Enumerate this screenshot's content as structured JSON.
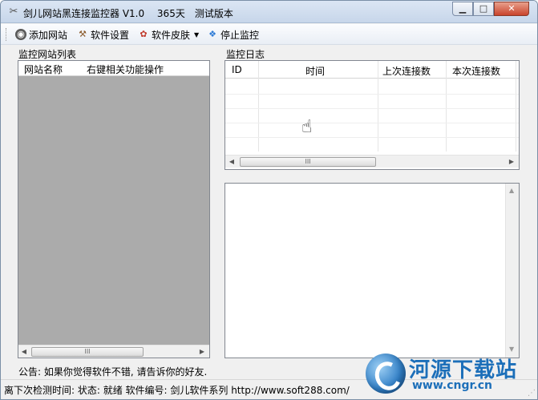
{
  "window": {
    "title": "剑儿网站黑连接监控器 V1.0　 365天　测试版本",
    "minimize_label": "▭",
    "maximize_label": "□",
    "close_label": "✕"
  },
  "toolbar": {
    "add_site": "添加网站",
    "settings": "软件设置",
    "skin": "软件皮肤",
    "stop": "停止监控"
  },
  "site_list": {
    "label": "监控网站列表",
    "columns": [
      "网站名称",
      "右键相关功能操作"
    ]
  },
  "monitor_log": {
    "label": "监控日志",
    "columns": [
      "ID",
      "时间",
      "上次连接数",
      "本次连接数"
    ]
  },
  "scrollbar": {
    "thumb_grip": "III"
  },
  "notice": "公告: 如果你觉得软件不错, 请告诉你的好友.",
  "status": "离下次检测时间:  状态: 就绪  软件编号: 剑儿软件系列  http://www.soft288.com/",
  "watermark": {
    "name": "河源下载站",
    "url": "www.cngr.cn"
  },
  "colors": {
    "list_body": "#ababab",
    "titlebar": "#c7d6ea",
    "watermark": "#1c6fb9",
    "close_button": "#c9442c"
  }
}
